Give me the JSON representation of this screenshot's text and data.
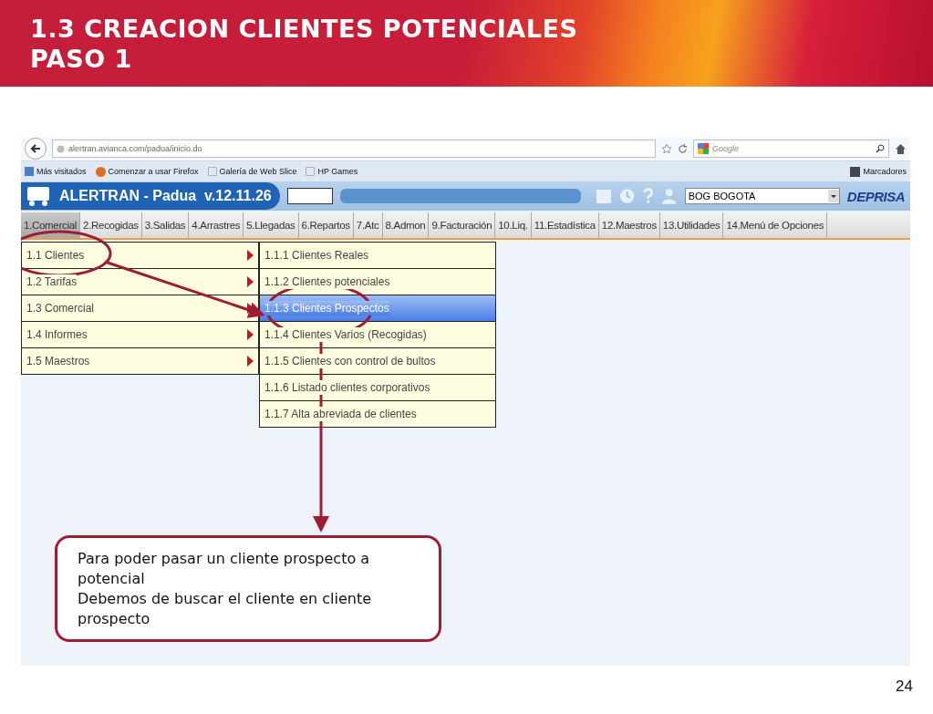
{
  "slide": {
    "title_lines": [
      "1.3 CREACION CLIENTES POTENCIALES",
      "PASO 1"
    ],
    "page_number": "24"
  },
  "browser": {
    "url": "alertran.avianca.com/padua/inicio.do",
    "search_placeholder": "Google",
    "bookmarks": [
      {
        "label": "Más visitados",
        "kind": "site"
      },
      {
        "label": "Comenzar a usar Firefox",
        "kind": "firefox"
      },
      {
        "label": "Galería de Web Slice",
        "kind": "slice"
      },
      {
        "label": "HP Games",
        "kind": "slice"
      }
    ],
    "bookmarks_menu": "Marcadores"
  },
  "app": {
    "title": "ALERTRAN - Padua  v.12.11.26",
    "office": "BOG BOGOTA",
    "brand": "DEPRISA",
    "tabs": [
      {
        "label": "1.Comercial",
        "selected": true
      },
      {
        "label": "2.Recogidas",
        "selected": false
      },
      {
        "label": "3.Salidas",
        "selected": false
      },
      {
        "label": "4.Arrastres",
        "selected": false
      },
      {
        "label": "5.Llegadas",
        "selected": false
      },
      {
        "label": "6.Repartos",
        "selected": false
      },
      {
        "label": "7.Atc",
        "selected": false
      },
      {
        "label": "8.Admon",
        "selected": false
      },
      {
        "label": "9.Facturación",
        "selected": false
      },
      {
        "label": "10.Liq.",
        "selected": false
      },
      {
        "label": "11.Estadística",
        "selected": false
      },
      {
        "label": "12.Maestros",
        "selected": false
      },
      {
        "label": "13.Utilidades",
        "selected": false
      },
      {
        "label": "14.Menú de Opciones",
        "selected": false
      }
    ],
    "menu": [
      {
        "label": "1.1 Clientes",
        "selected": false
      },
      {
        "label": "1.2 Tarifas",
        "selected": false
      },
      {
        "label": "1.3 Comercial",
        "selected": false
      },
      {
        "label": "1.4 Informes",
        "selected": false
      },
      {
        "label": "1.5 Maestros",
        "selected": false
      }
    ],
    "submenu": [
      {
        "label": "1.1.1 Clientes Reales",
        "selected": false
      },
      {
        "label": "1.1.2 Clientes potenciales",
        "selected": false
      },
      {
        "label": "1.1.3 Clientes Prospectos",
        "selected": true
      },
      {
        "label": "1.1.4 Clientes Varios (Recogidas)",
        "selected": false
      },
      {
        "label": "1.1.5 Clientes con control de bultos",
        "selected": false
      },
      {
        "label": "1.1.6 Listado clientes corporativos",
        "selected": false
      },
      {
        "label": "1.1.7 Alta abreviada de clientes",
        "selected": false
      }
    ]
  },
  "callout": {
    "lines": [
      "Para poder pasar un cliente prospecto a potencial",
      "Debemos de buscar el cliente en cliente prospecto"
    ]
  }
}
